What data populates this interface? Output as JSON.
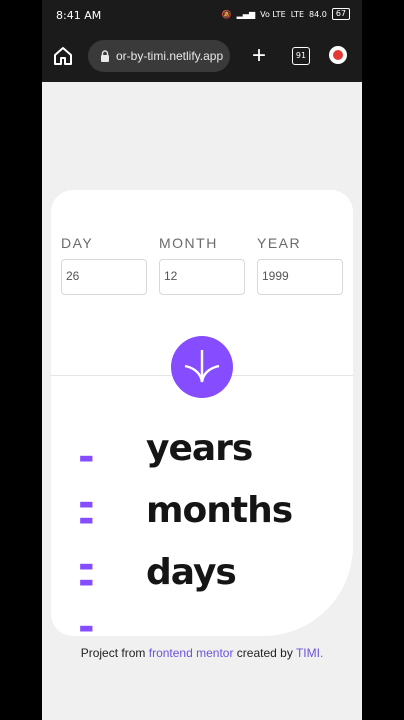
{
  "status_bar": {
    "time": "8:41 AM",
    "network": "Vo LTE",
    "lte": "LTE",
    "speed": "84.0",
    "battery": "67"
  },
  "browser": {
    "url": "or-by-timi.netlify.app",
    "tab_count": "91"
  },
  "form": {
    "fields": [
      {
        "label": "DAY",
        "value": "26"
      },
      {
        "label": "MONTH",
        "value": "12"
      },
      {
        "label": "YEAR",
        "value": "1999"
      }
    ]
  },
  "results": [
    {
      "value": "- -",
      "label": "years"
    },
    {
      "value": "- -",
      "label": "months"
    },
    {
      "value": "- -",
      "label": "days"
    }
  ],
  "attribution": {
    "prefix": "Project from",
    "link1": "frontend mentor",
    "middle": "created by",
    "link2": "TIMI."
  },
  "colors": {
    "accent": "#854dff",
    "text": "#151515"
  }
}
